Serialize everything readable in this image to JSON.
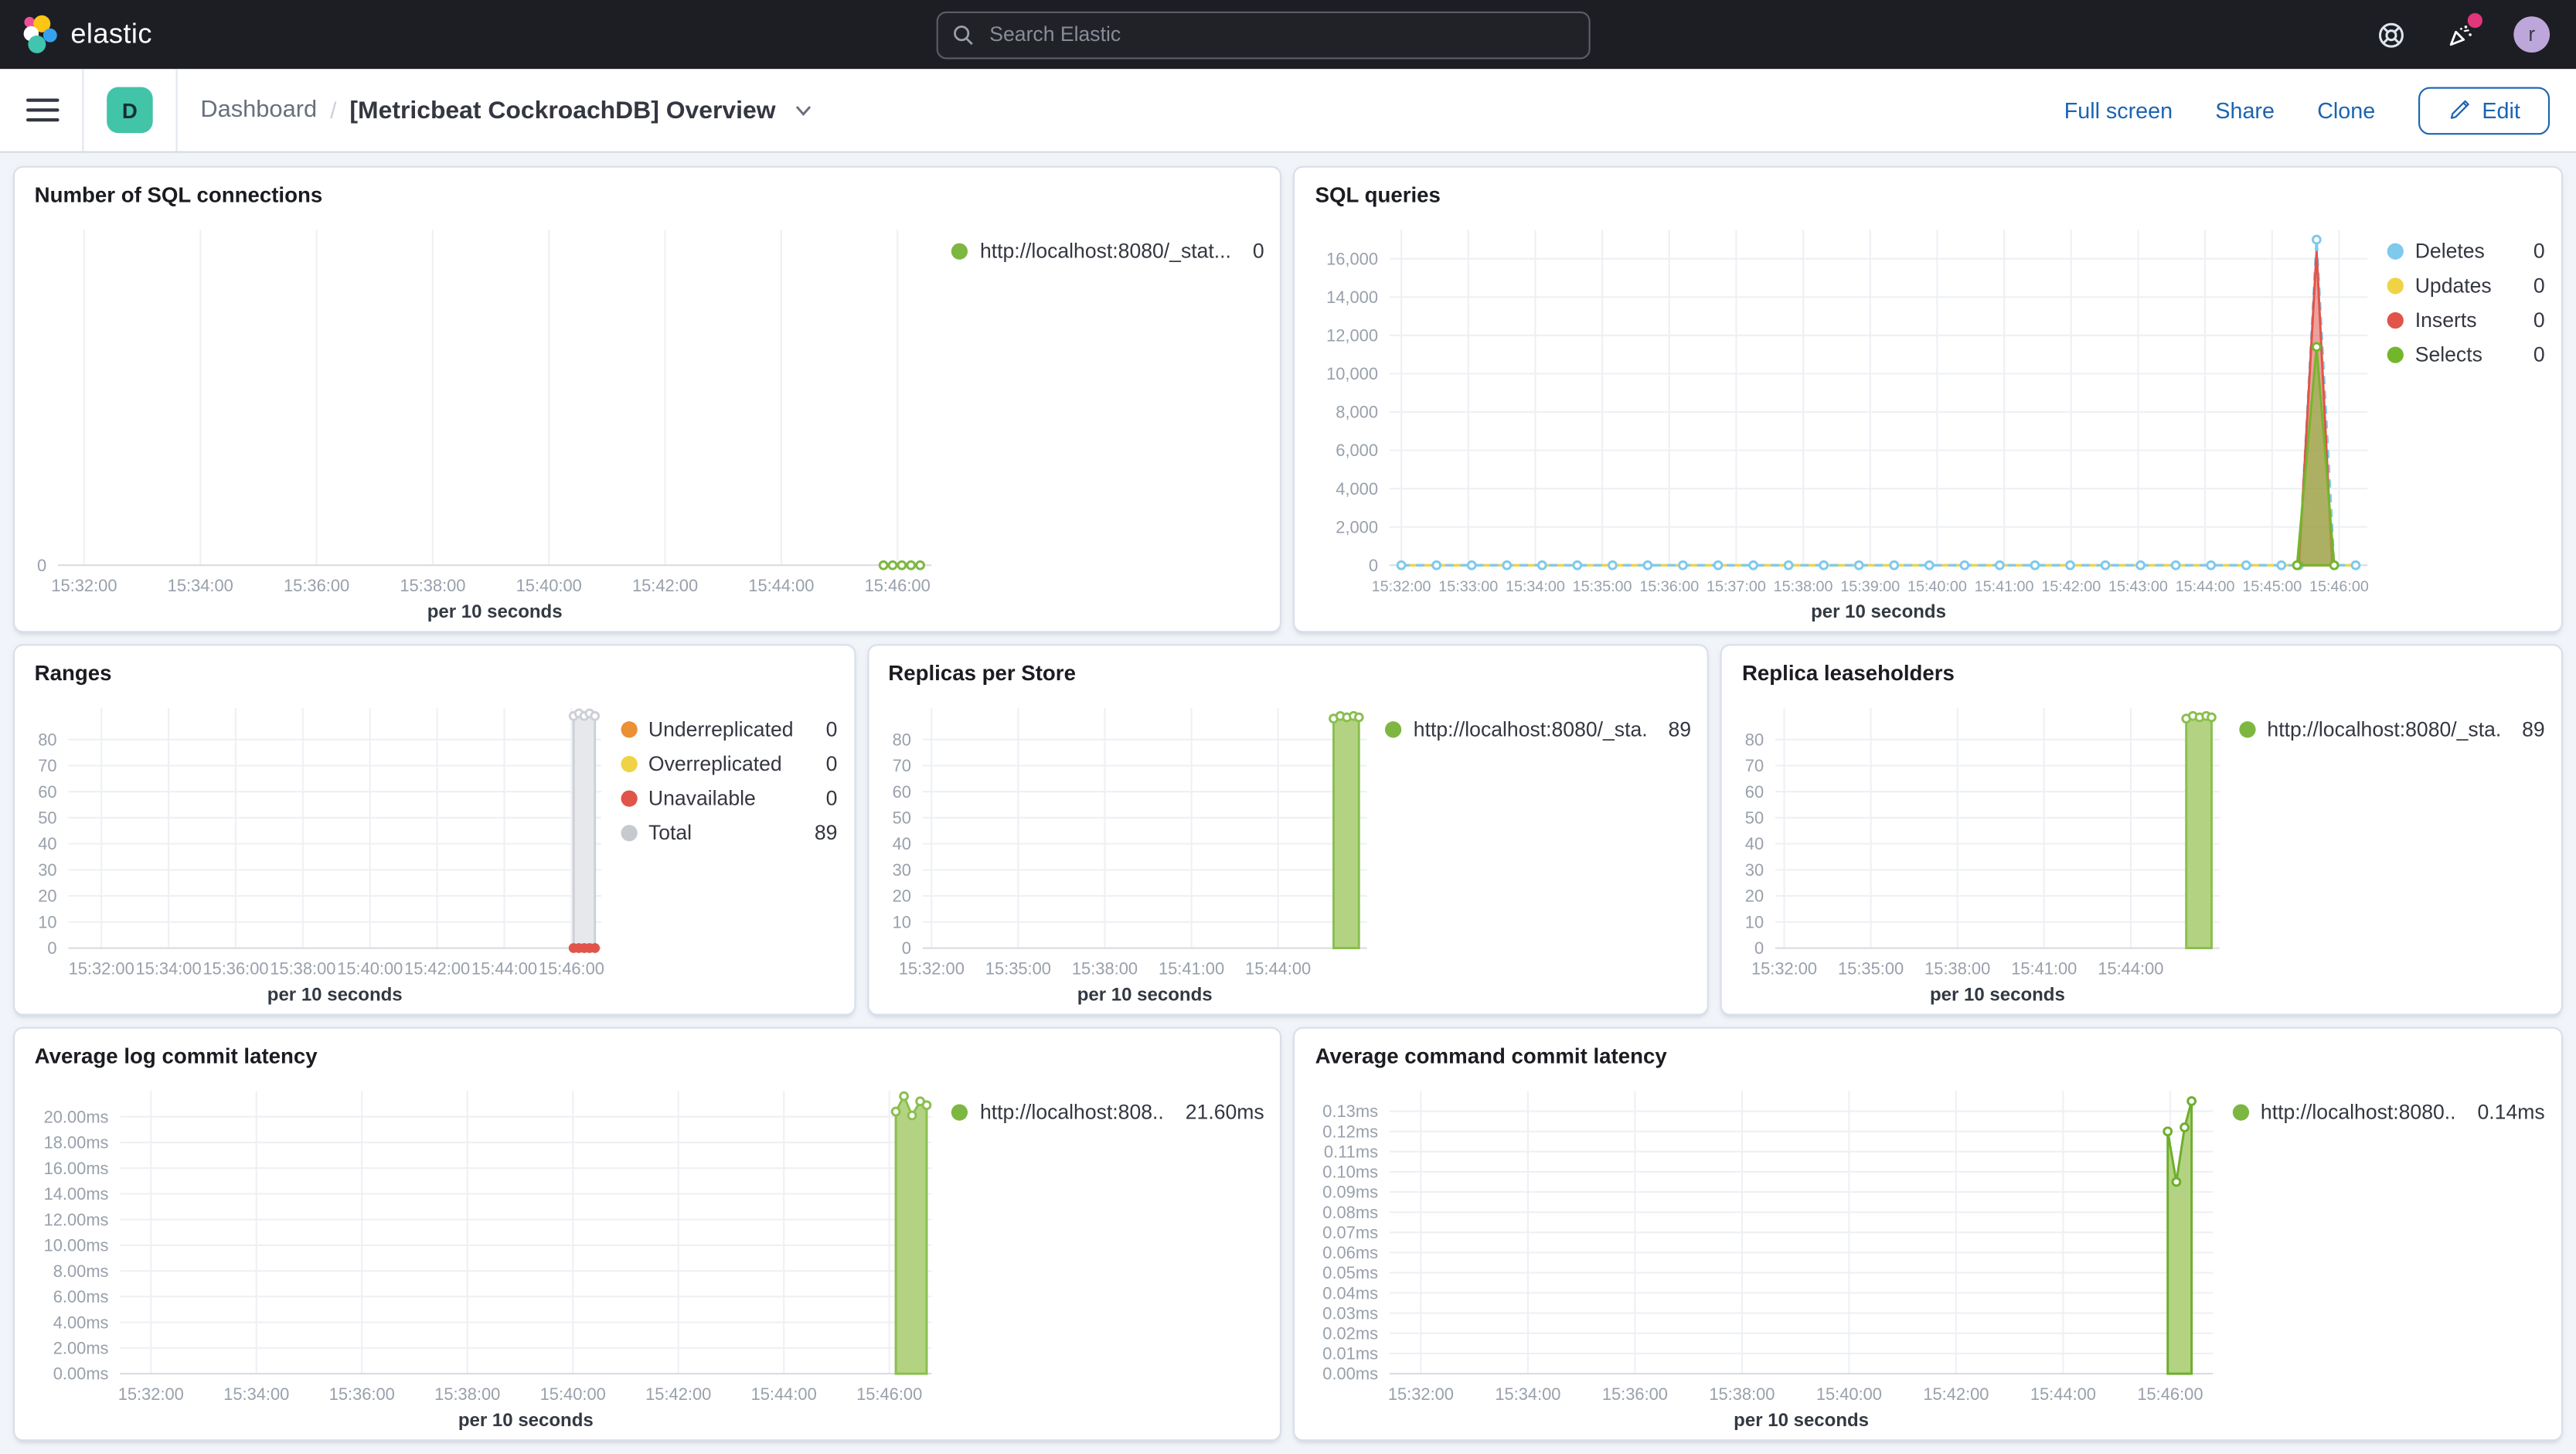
{
  "navbar": {
    "brand": "elastic",
    "search_placeholder": "Search Elastic",
    "avatar_initial": "r"
  },
  "breadcrumbs": {
    "app_badge": "D",
    "section": "Dashboard",
    "separator": "/",
    "page": "[Metricbeat CockroachDB] Overview"
  },
  "actions": {
    "full_screen": "Full screen",
    "share": "Share",
    "clone": "Clone",
    "edit": "Edit"
  },
  "panels": [
    {
      "title": "Number of SQL connections",
      "legend": [
        {
          "label": "http://localhost:8080/_stat...",
          "value": "0",
          "color": "#7db742"
        }
      ]
    },
    {
      "title": "SQL queries",
      "legend": [
        {
          "label": "Deletes",
          "value": "0",
          "color": "#7fc9ec"
        },
        {
          "label": "Updates",
          "value": "0",
          "color": "#efd344"
        },
        {
          "label": "Inserts",
          "value": "0",
          "color": "#e0544a"
        },
        {
          "label": "Selects",
          "value": "0",
          "color": "#74b62b"
        }
      ]
    },
    {
      "title": "Ranges",
      "legend": [
        {
          "label": "Underreplicated",
          "value": "0",
          "color": "#eb9035"
        },
        {
          "label": "Overreplicated",
          "value": "0",
          "color": "#efd344"
        },
        {
          "label": "Unavailable",
          "value": "0",
          "color": "#e0544a"
        },
        {
          "label": "Total",
          "value": "89",
          "color": "#c6c9ce"
        }
      ]
    },
    {
      "title": "Replicas per Store",
      "legend": [
        {
          "label": "http://localhost:8080/_sta...",
          "value": "89",
          "color": "#7db742"
        }
      ]
    },
    {
      "title": "Replica leaseholders",
      "legend": [
        {
          "label": "http://localhost:8080/_sta...",
          "value": "89",
          "color": "#7db742"
        }
      ]
    },
    {
      "title": "Average log commit latency",
      "legend": [
        {
          "label": "http://localhost:808...",
          "value": "21.60ms",
          "color": "#7db742"
        }
      ]
    },
    {
      "title": "Average command commit latency",
      "legend": [
        {
          "label": "http://localhost:8080...",
          "value": "0.14ms",
          "color": "#7db742"
        }
      ]
    }
  ],
  "chart_data": [
    {
      "type": "line",
      "title": "Number of SQL connections",
      "xlabel": "per 10 seconds",
      "x_ticks": [
        "15:32:00",
        "15:34:00",
        "15:36:00",
        "15:38:00",
        "15:40:00",
        "15:42:00",
        "15:44:00",
        "15:46:00"
      ],
      "x_tick_start": 0.03,
      "x_tick_step": 0.133,
      "y_tick_values": [
        0
      ],
      "y_tick_labels": [
        "0"
      ],
      "ylim": [
        0,
        8
      ],
      "series": [
        {
          "name": "http://localhost:8080/_stat...",
          "color": "#7db742",
          "type": "line",
          "markers": true,
          "points": [
            [
              0.945,
              0
            ],
            [
              0.9555,
              0
            ],
            [
              0.966,
              0
            ],
            [
              0.9765,
              0
            ],
            [
              0.987,
              0
            ]
          ]
        }
      ]
    },
    {
      "type": "area",
      "title": "SQL queries",
      "xlabel": "per 10 seconds",
      "x_ticks": [
        "15:32:00",
        "15:33:00",
        "15:34:00",
        "15:35:00",
        "15:36:00",
        "15:37:00",
        "15:38:00",
        "15:39:00",
        "15:40:00",
        "15:41:00",
        "15:42:00",
        "15:43:00",
        "15:44:00",
        "15:45:00",
        "15:46:00"
      ],
      "x_tick_start": 0.012,
      "x_tick_step": 0.0685,
      "y_tick_values": [
        0,
        2000,
        4000,
        6000,
        8000,
        10000,
        12000,
        14000,
        16000
      ],
      "y_tick_labels": [
        "0",
        "2,000",
        "4,000",
        "6,000",
        "8,000",
        "10,000",
        "12,000",
        "14,000",
        "16,000"
      ],
      "ylim": [
        0,
        17500
      ],
      "series": [
        {
          "name": "Updates",
          "color": "#efd344",
          "type": "line",
          "points": [
            [
              0.012,
              0
            ],
            [
              0.988,
              0
            ]
          ]
        },
        {
          "name": "Deletes",
          "color": "#7fc9ec",
          "type": "line",
          "dashed": true,
          "markers": true,
          "points": [
            [
              0.012,
              0
            ],
            [
              0.048,
              0
            ],
            [
              0.084,
              0
            ],
            [
              0.12,
              0
            ],
            [
              0.156,
              0
            ],
            [
              0.192,
              0
            ],
            [
              0.228,
              0
            ],
            [
              0.264,
              0
            ],
            [
              0.3,
              0
            ],
            [
              0.336,
              0
            ],
            [
              0.372,
              0
            ],
            [
              0.408,
              0
            ],
            [
              0.444,
              0
            ],
            [
              0.48,
              0
            ],
            [
              0.516,
              0
            ],
            [
              0.552,
              0
            ],
            [
              0.588,
              0
            ],
            [
              0.624,
              0
            ],
            [
              0.66,
              0
            ],
            [
              0.696,
              0
            ],
            [
              0.732,
              0
            ],
            [
              0.768,
              0
            ],
            [
              0.804,
              0
            ],
            [
              0.84,
              0
            ],
            [
              0.876,
              0
            ],
            [
              0.912,
              0
            ],
            [
              0.93,
              0
            ],
            [
              0.948,
              17000
            ],
            [
              0.966,
              0
            ],
            [
              0.988,
              0
            ]
          ]
        },
        {
          "name": "Inserts",
          "color": "#e0544a",
          "type": "area",
          "fill": "rgba(224,84,74,0.55)",
          "points": [
            [
              0.93,
              0
            ],
            [
              0.948,
              16400
            ],
            [
              0.964,
              0
            ]
          ]
        },
        {
          "name": "Selects",
          "color": "#74b62b",
          "type": "area",
          "fill": "rgba(130,186,62,0.6)",
          "markers": true,
          "points": [
            [
              0.928,
              0
            ],
            [
              0.948,
              11400
            ],
            [
              0.966,
              0
            ]
          ]
        }
      ]
    },
    {
      "type": "area",
      "title": "Ranges",
      "xlabel": "per 10 seconds",
      "x_ticks": [
        "15:32:00",
        "15:34:00",
        "15:36:00",
        "15:38:00",
        "15:40:00",
        "15:42:00",
        "15:44:00",
        "15:46:00"
      ],
      "x_tick_start": 0.062,
      "x_tick_step": 0.126,
      "y_tick_values": [
        0,
        10,
        20,
        30,
        40,
        50,
        60,
        70,
        80
      ],
      "y_tick_labels": [
        "0",
        "10",
        "20",
        "30",
        "40",
        "50",
        "60",
        "70",
        "80"
      ],
      "ylim": [
        0,
        92
      ],
      "series": [
        {
          "name": "Total",
          "color": "#cdd0d6",
          "type": "area",
          "fill": "#e6e8ec",
          "markers": true,
          "points": [
            [
              0.948,
              89
            ],
            [
              0.958,
              90
            ],
            [
              0.968,
              89
            ],
            [
              0.978,
              90
            ],
            [
              0.988,
              89
            ]
          ]
        },
        {
          "name": "Unavailable",
          "color": "#e0544a",
          "type": "scatter",
          "solid_markers": true,
          "points": [
            [
              0.948,
              0
            ],
            [
              0.958,
              0
            ],
            [
              0.968,
              0
            ],
            [
              0.978,
              0
            ],
            [
              0.988,
              0
            ]
          ]
        }
      ]
    },
    {
      "type": "area",
      "title": "Replicas per Store",
      "xlabel": "per 10 seconds",
      "x_ticks": [
        "15:32:00",
        "15:35:00",
        "15:38:00",
        "15:41:00",
        "15:44:00"
      ],
      "x_tick_start": 0.02,
      "x_tick_step": 0.195,
      "y_tick_values": [
        0,
        10,
        20,
        30,
        40,
        50,
        60,
        70,
        80
      ],
      "y_tick_labels": [
        "0",
        "10",
        "20",
        "30",
        "40",
        "50",
        "60",
        "70",
        "80"
      ],
      "ylim": [
        0,
        92
      ],
      "series": [
        {
          "name": "http://localhost:8080/_sta...",
          "color": "#8abf4f",
          "type": "area",
          "fill": "#b3d383",
          "markers": true,
          "points": [
            [
              0.925,
              88
            ],
            [
              0.94,
              89
            ],
            [
              0.955,
              88.5
            ],
            [
              0.97,
              89
            ],
            [
              0.982,
              88.5
            ]
          ]
        }
      ]
    },
    {
      "type": "area",
      "title": "Replica leaseholders",
      "xlabel": "per 10 seconds",
      "x_ticks": [
        "15:32:00",
        "15:35:00",
        "15:38:00",
        "15:41:00",
        "15:44:00"
      ],
      "x_tick_start": 0.02,
      "x_tick_step": 0.195,
      "y_tick_values": [
        0,
        10,
        20,
        30,
        40,
        50,
        60,
        70,
        80
      ],
      "y_tick_labels": [
        "0",
        "10",
        "20",
        "30",
        "40",
        "50",
        "60",
        "70",
        "80"
      ],
      "ylim": [
        0,
        92
      ],
      "series": [
        {
          "name": "http://localhost:8080/_sta...",
          "color": "#8abf4f",
          "type": "area",
          "fill": "#b3d383",
          "markers": true,
          "points": [
            [
              0.925,
              88
            ],
            [
              0.94,
              89
            ],
            [
              0.955,
              88.5
            ],
            [
              0.97,
              89
            ],
            [
              0.982,
              88.5
            ]
          ]
        }
      ]
    },
    {
      "type": "area",
      "title": "Average log commit latency",
      "xlabel": "per 10 seconds",
      "x_ticks": [
        "15:32:00",
        "15:34:00",
        "15:36:00",
        "15:38:00",
        "15:40:00",
        "15:42:00",
        "15:44:00",
        "15:46:00"
      ],
      "x_tick_start": 0.038,
      "x_tick_step": 0.13,
      "y_tick_values": [
        0,
        2,
        4,
        6,
        8,
        10,
        12,
        14,
        16,
        18,
        20
      ],
      "y_tick_labels": [
        "0.00ms",
        "2.00ms",
        "4.00ms",
        "6.00ms",
        "8.00ms",
        "10.00ms",
        "12.00ms",
        "14.00ms",
        "16.00ms",
        "18.00ms",
        "20.00ms"
      ],
      "ylim": [
        0,
        22
      ],
      "series": [
        {
          "name": "http://localhost:808...",
          "color": "#8abf4f",
          "type": "area",
          "fill": "#b3d383",
          "markers": true,
          "points": [
            [
              0.956,
              20.4
            ],
            [
              0.966,
              21.6
            ],
            [
              0.976,
              20.1
            ],
            [
              0.986,
              21.2
            ],
            [
              0.994,
              20.9
            ]
          ]
        }
      ]
    },
    {
      "type": "area",
      "title": "Average command commit latency",
      "xlabel": "per 10 seconds",
      "x_ticks": [
        "15:32:00",
        "15:34:00",
        "15:36:00",
        "15:38:00",
        "15:40:00",
        "15:42:00",
        "15:44:00",
        "15:46:00"
      ],
      "x_tick_start": 0.038,
      "x_tick_step": 0.13,
      "y_tick_values": [
        0,
        0.01,
        0.02,
        0.03,
        0.04,
        0.05,
        0.06,
        0.07,
        0.08,
        0.09,
        0.1,
        0.11,
        0.12,
        0.13
      ],
      "y_tick_labels": [
        "0.00ms",
        "0.01ms",
        "0.02ms",
        "0.03ms",
        "0.04ms",
        "0.05ms",
        "0.06ms",
        "0.07ms",
        "0.08ms",
        "0.09ms",
        "0.10ms",
        "0.11ms",
        "0.12ms",
        "0.13ms"
      ],
      "ylim": [
        0,
        0.14
      ],
      "series": [
        {
          "name": "http://localhost:8080...",
          "color": "#6fae2c",
          "type": "area",
          "fill": "#b3d383",
          "markers": true,
          "points": [
            [
              0.945,
              0.12
            ],
            [
              0.9555,
              0.095
            ],
            [
              0.9655,
              0.122
            ],
            [
              0.974,
              0.135
            ]
          ]
        }
      ]
    }
  ]
}
